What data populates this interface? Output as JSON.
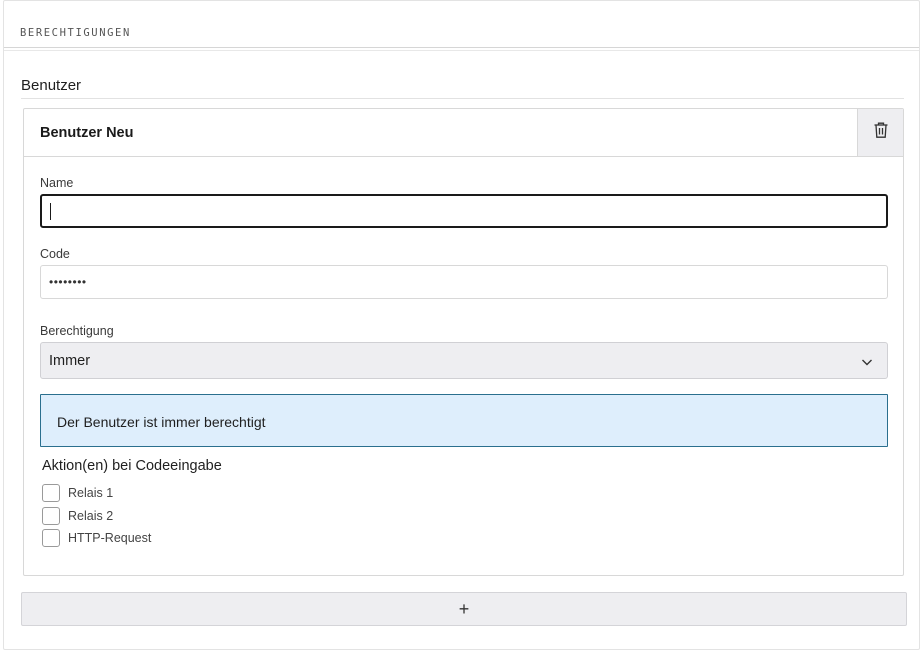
{
  "section": {
    "title": "BERECHTIGUNGEN"
  },
  "group": {
    "title": "Benutzer"
  },
  "user_card": {
    "title": "Benutzer Neu",
    "delete_icon": "trash-icon",
    "name": {
      "label": "Name",
      "value": ""
    },
    "code": {
      "label": "Code",
      "value": "••••••••"
    },
    "permission": {
      "label": "Berechtigung",
      "selected": "Immer",
      "icon": "chevron-down-icon"
    },
    "info": {
      "text": "Der Benutzer ist immer berechtigt"
    },
    "actions": {
      "title": "Aktion(en) bei Codeeingabe",
      "options": [
        {
          "label": "Relais 1",
          "checked": false
        },
        {
          "label": "Relais 2",
          "checked": false
        },
        {
          "label": "HTTP-Request",
          "checked": false
        }
      ]
    }
  },
  "add_button": {
    "label": "+"
  },
  "colors": {
    "info_background": "#deeefc",
    "info_border": "#2a6f8e",
    "control_background": "#eeeef1"
  }
}
